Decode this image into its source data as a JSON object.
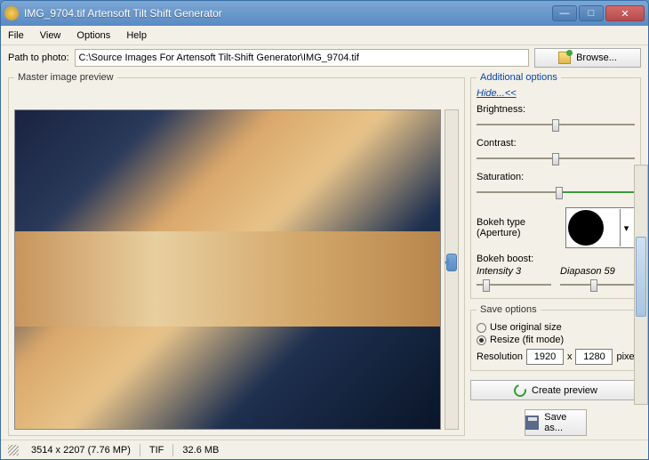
{
  "window": {
    "title": "IMG_9704.tif Artensoft Tilt Shift Generator"
  },
  "menu": {
    "file": "File",
    "view": "View",
    "options": "Options",
    "help": "Help"
  },
  "path": {
    "label": "Path to photo:",
    "value": "C:\\Source Images For Artensoft Tilt-Shift Generator\\IMG_9704.tif",
    "browse": "Browse..."
  },
  "preview": {
    "legend": "Master image preview"
  },
  "opts": {
    "legend": "Additional options",
    "hide": "Hide...<<",
    "brightness": "Brightness:",
    "contrast": "Contrast:",
    "saturation": "Saturation:",
    "bokeh_type": "Bokeh type (Aperture)",
    "bokeh_boost": "Bokeh boost:",
    "intensity": "Intensity 3",
    "diapason": "Diapason 59"
  },
  "save": {
    "legend": "Save options",
    "orig": "Use original size",
    "resize": "Resize (fit mode)",
    "resolution": "Resolution",
    "w": "1920",
    "h": "1280",
    "px": "pixels",
    "x": "x"
  },
  "buttons": {
    "create": "Create preview",
    "saveas": "Save as..."
  },
  "status": {
    "dims": "3514 x 2207 (7.76 MP)",
    "fmt": "TIF",
    "size": "32.6 MB"
  }
}
